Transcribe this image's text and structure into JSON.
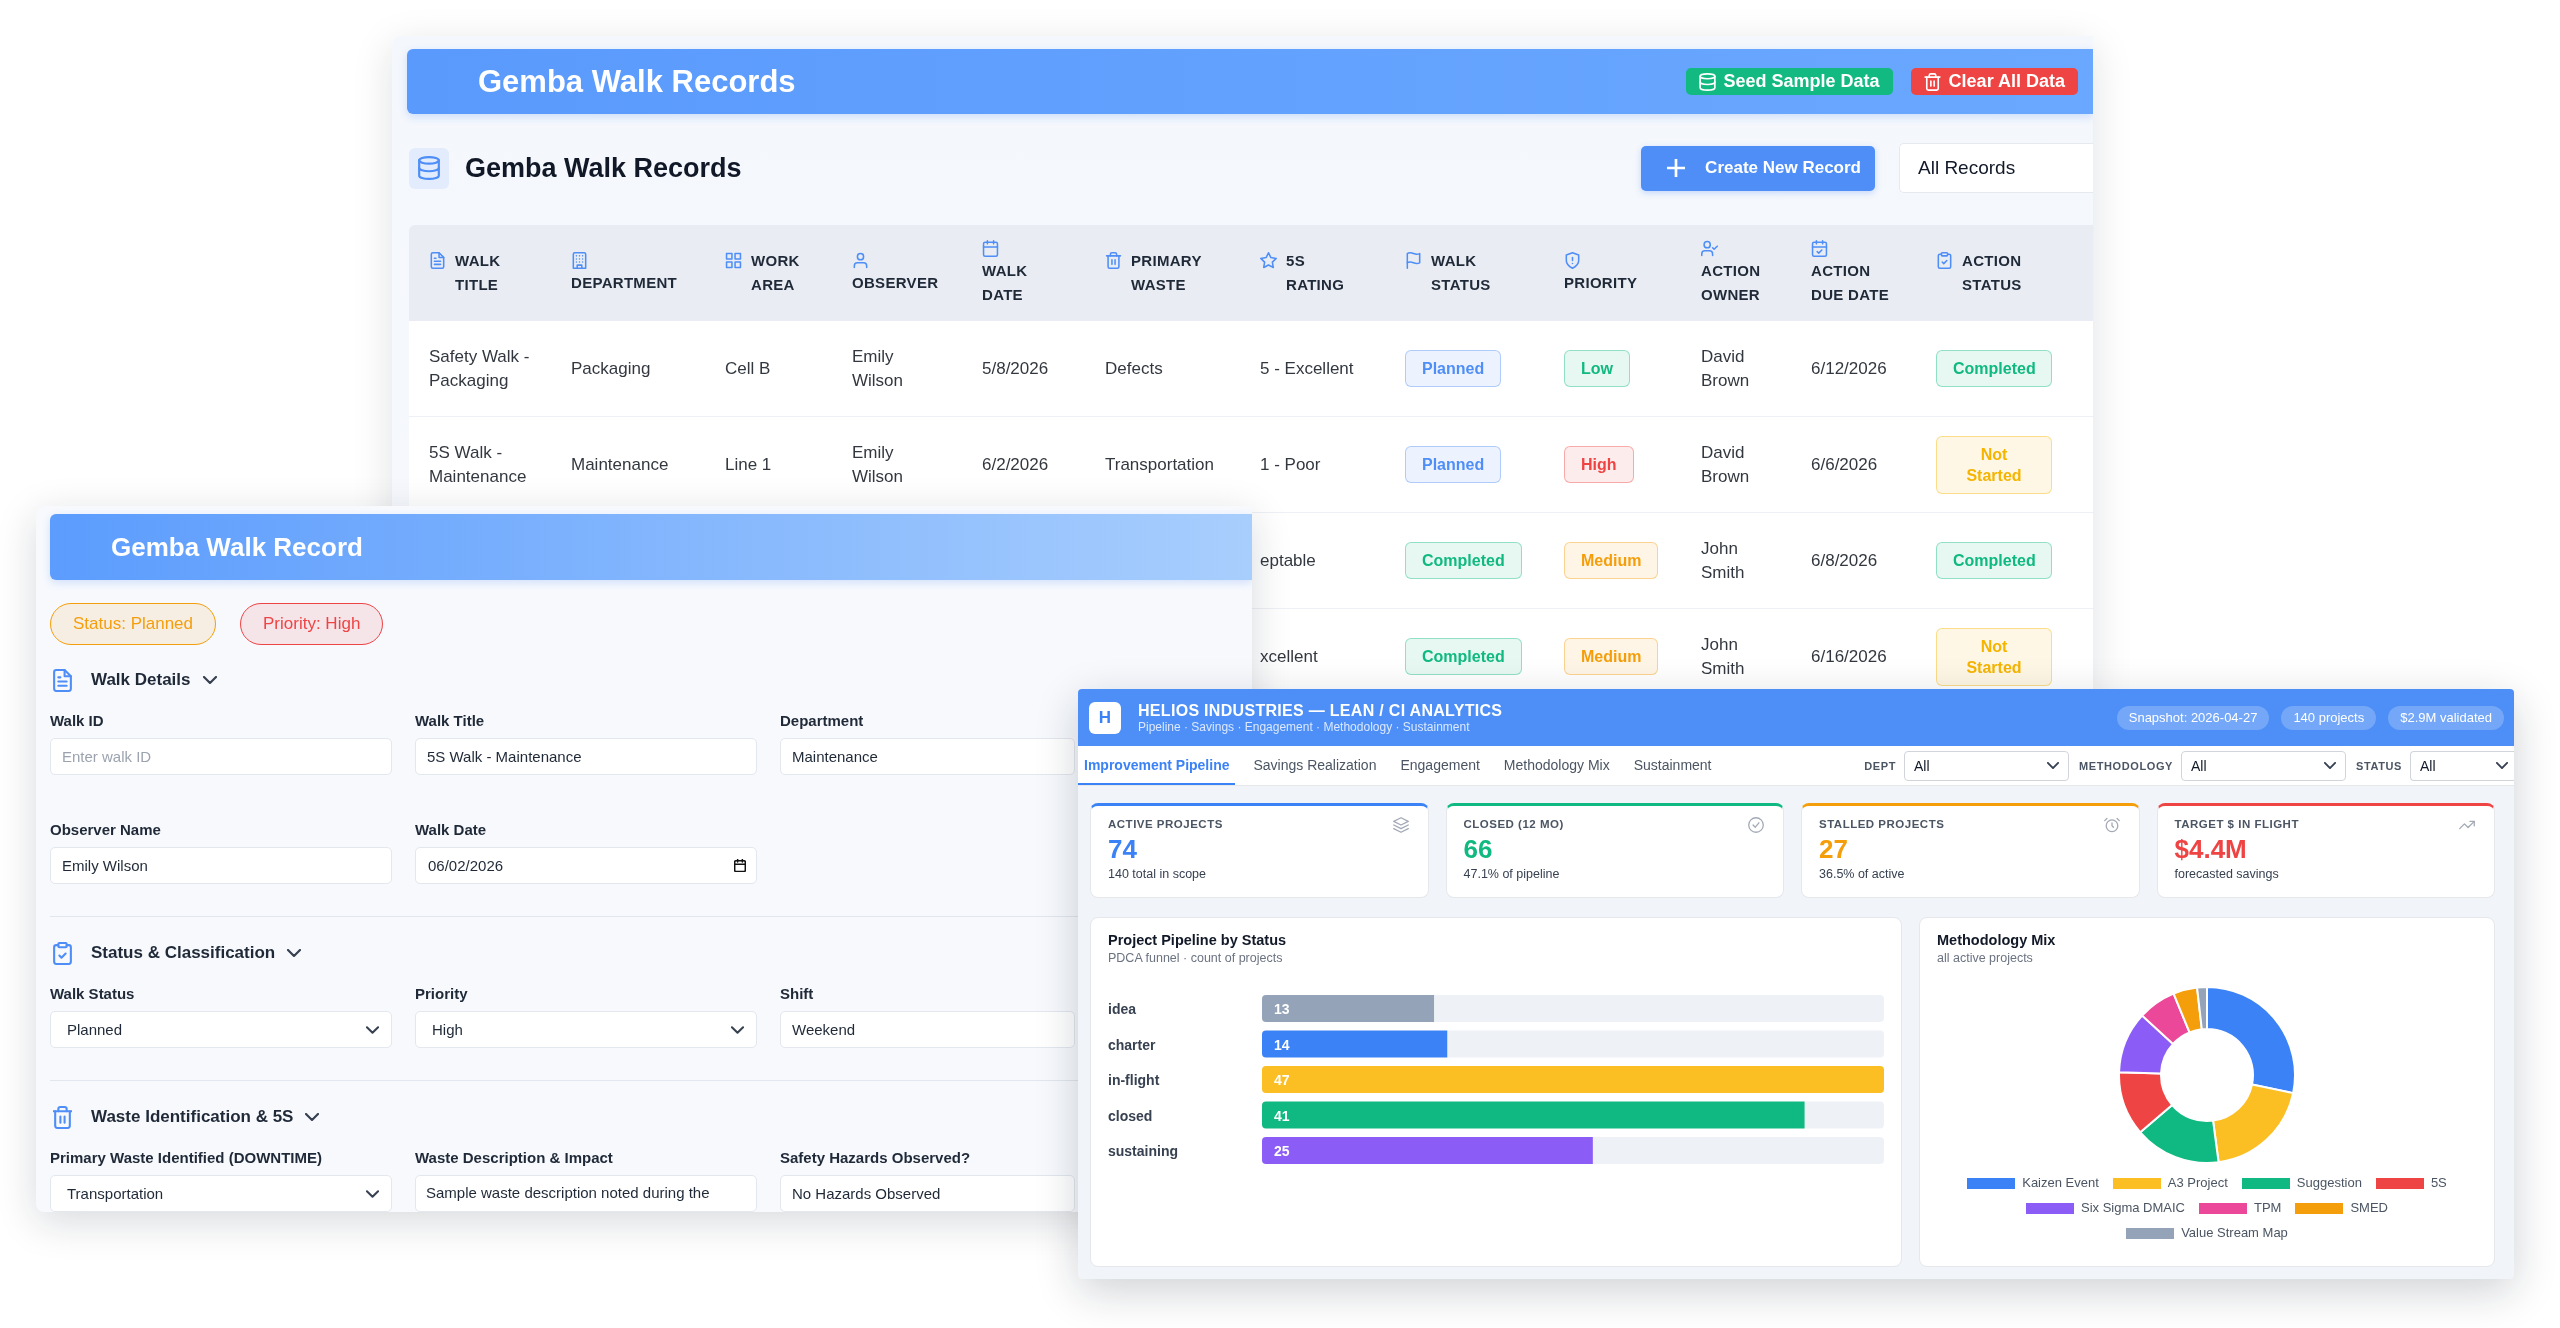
{
  "records_window": {
    "title": "Gemba Walk Records",
    "actions": [
      {
        "label": "Seed Sample Data",
        "kind": "success"
      },
      {
        "label": "Clear All Data",
        "kind": "danger"
      }
    ],
    "list_title": "Gemba Walk Records",
    "create_button": "Create New Record",
    "filter": "All Records",
    "table": {
      "columns": [
        "WALK TITLE",
        "DEPARTMENT",
        "WORK AREA",
        "OBSERVER",
        "WALK DATE",
        "PRIMARY WASTE",
        "5S RATING",
        "WALK STATUS",
        "PRIORITY",
        "ACTION OWNER",
        "ACTION DUE DATE",
        "ACTION STATUS"
      ],
      "rows": [
        {
          "walk_title": "Safety Walk - Packaging",
          "department": "Packaging",
          "work_area": "Cell B",
          "observer": "Emily Wilson",
          "walk_date": "5/8/2026",
          "primary_waste": "Defects",
          "rating": "5 - Excellent",
          "walk_status": {
            "label": "Planned",
            "color": "#4f8ef7"
          },
          "priority": {
            "label": "Low",
            "color": "#10b981"
          },
          "action_owner": "David Brown",
          "action_due_date": "6/12/2026",
          "action_status": {
            "label": "Completed",
            "color": "#10b981"
          }
        },
        {
          "walk_title": "5S Walk - Maintenance",
          "department": "Maintenance",
          "work_area": "Line 1",
          "observer": "Emily Wilson",
          "walk_date": "6/2/2026",
          "primary_waste": "Transportation",
          "rating": "1 - Poor",
          "walk_status": {
            "label": "Planned",
            "color": "#4f8ef7"
          },
          "priority": {
            "label": "High",
            "color": "#ef4444"
          },
          "action_owner": "David Brown",
          "action_due_date": "6/6/2026",
          "action_status": {
            "label": "Not Started",
            "color": "#f5b400"
          }
        },
        {
          "rating": "eptable",
          "walk_status": {
            "label": "Completed",
            "color": "#10b981"
          },
          "priority": {
            "label": "Medium",
            "color": "#f59e0b"
          },
          "action_owner": "John Smith",
          "action_due_date": "6/8/2026",
          "action_status": {
            "label": "Completed",
            "color": "#10b981"
          }
        },
        {
          "rating": "xcellent",
          "walk_status": {
            "label": "Completed",
            "color": "#10b981"
          },
          "priority": {
            "label": "Medium",
            "color": "#f59e0b"
          },
          "action_owner": "John Smith",
          "action_due_date": "6/16/2026",
          "action_status": {
            "label": "Not Started",
            "color": "#f5b400"
          }
        }
      ]
    }
  },
  "record_form": {
    "title": "Gemba Walk Record",
    "badges": [
      {
        "label": "Status: Planned",
        "color": "#f59e0b"
      },
      {
        "label": "Priority: High",
        "color": "#ef4444"
      }
    ],
    "sections": [
      {
        "title": "Walk Details",
        "expanded": true,
        "fields": [
          {
            "label": "Walk ID",
            "kind": "text",
            "placeholder": "Enter walk ID"
          },
          {
            "label": "Walk Title",
            "kind": "text",
            "value": "5S Walk - Maintenance"
          },
          {
            "label": "Department",
            "kind": "text",
            "value": "Maintenance"
          },
          {
            "label": "Observer Name",
            "kind": "text",
            "value": "Emily Wilson"
          },
          {
            "label": "Walk Date",
            "kind": "date",
            "value": "06/02/2026"
          }
        ]
      },
      {
        "title": "Status & Classification",
        "expanded": true,
        "fields": [
          {
            "label": "Walk Status",
            "kind": "select",
            "value": "Planned"
          },
          {
            "label": "Priority",
            "kind": "select",
            "value": "High"
          },
          {
            "label": "Shift",
            "kind": "text",
            "value": "Weekend"
          }
        ]
      },
      {
        "title": "Waste Identification & 5S",
        "expanded": true,
        "fields": [
          {
            "label": "Primary Waste Identified (DOWNTIME)",
            "kind": "select",
            "value": "Transportation"
          },
          {
            "label": "Waste Description & Impact",
            "kind": "textarea",
            "value": "Sample waste description noted during the"
          },
          {
            "label": "Safety Hazards Observed?",
            "kind": "text",
            "value": "No Hazards Observed"
          }
        ]
      }
    ]
  },
  "analytics": {
    "logo": "H",
    "title": "HELIOS INDUSTRIES — LEAN / CI ANALYTICS",
    "subtitle": "Pipeline · Savings · Engagement · Methodology · Sustainment",
    "chips": [
      "Snapshot: 2026-04-27",
      "140 projects",
      "$2.9M validated"
    ],
    "tabs": [
      {
        "label": "Improvement Pipeline",
        "selected": true
      },
      {
        "label": "Savings Realization",
        "selected": false
      },
      {
        "label": "Engagement",
        "selected": false
      },
      {
        "label": "Methodology Mix",
        "selected": false
      },
      {
        "label": "Sustainment",
        "selected": false
      }
    ],
    "filters": [
      {
        "label": "DEPT",
        "value": "All"
      },
      {
        "label": "METHODOLOGY",
        "value": "All"
      },
      {
        "label": "STATUS",
        "value": "All"
      }
    ],
    "kpis": [
      {
        "label": "ACTIVE PROJECTS",
        "value": "74",
        "note": "140 total in scope",
        "color": "#3b82f6"
      },
      {
        "label": "CLOSED (12 MO)",
        "value": "66",
        "note": "47.1% of pipeline",
        "color": "#10b981"
      },
      {
        "label": "STALLED PROJECTS",
        "value": "27",
        "note": "36.5% of active",
        "color": "#f59e0b"
      },
      {
        "label": "TARGET $ IN FLIGHT",
        "value": "$4.4M",
        "note": "forecasted savings",
        "color": "#ef4444"
      }
    ],
    "pipeline": {
      "subtitle": "PDCA funnel · count of projects",
      "chart_data": {
        "type": "bar",
        "orientation": "horizontal",
        "title": "Project Pipeline by Status",
        "categories": [
          "idea",
          "charter",
          "in-flight",
          "closed",
          "sustaining"
        ],
        "values": [
          13,
          14,
          47,
          41,
          25
        ],
        "colors": [
          "#94a3b8",
          "#3b82f6",
          "#fbbf24",
          "#10b981",
          "#8b5cf6"
        ],
        "data_labels": true
      }
    },
    "methodology": {
      "title": "Methodology Mix",
      "subtitle": "all active projects",
      "legend": [
        {
          "label": "Kaizen Event",
          "color": "#3b82f6"
        },
        {
          "label": "A3 Project",
          "color": "#fbbf24"
        },
        {
          "label": "Suggestion",
          "color": "#10b981"
        },
        {
          "label": "5S",
          "color": "#ef4444"
        },
        {
          "label": "Six Sigma DMAIC",
          "color": "#8b5cf6"
        },
        {
          "label": "TPM",
          "color": "#ec4899"
        },
        {
          "label": "SMED",
          "color": "#f59e0b"
        },
        {
          "label": "Value Stream Map",
          "color": "#94a3b8"
        }
      ]
    }
  }
}
